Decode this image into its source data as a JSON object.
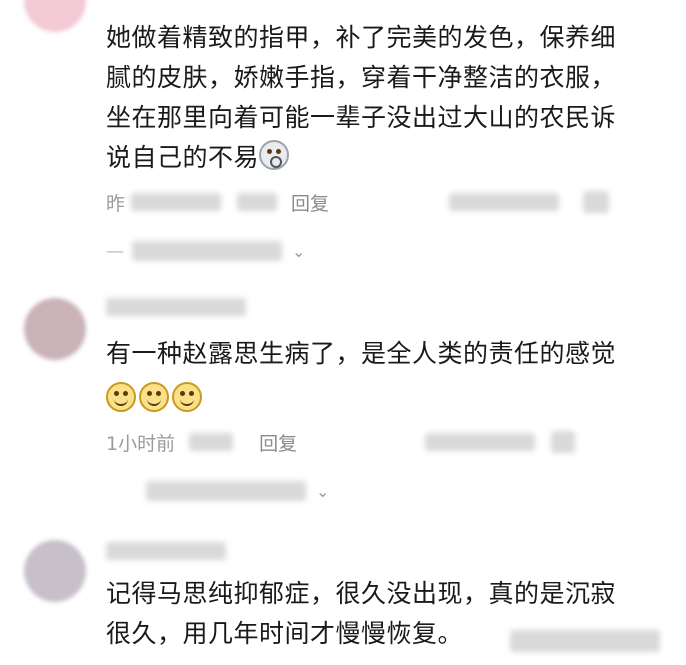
{
  "comments": [
    {
      "lines": [
        "她做着精致的指甲，补了完美的发色，保养细",
        "腻的皮肤，娇嫩手指，穿着干净整洁的衣服，",
        "坐在那里向着可能一辈子没出过大山的农民诉",
        "说自己的不易"
      ],
      "emoji": "scared-face",
      "time": "昨",
      "reply": "回复",
      "sub_dash": "—",
      "avatar_color": "#f2c9d4"
    },
    {
      "lines": [
        "有一种赵露思生病了，是全人类的责任的感觉"
      ],
      "emoji": "smiling-face",
      "emoji_count": 3,
      "time": "1小时前",
      "reply": "回复",
      "avatar_color": "#c9b2b8"
    },
    {
      "lines": [
        "记得马思纯抑郁症，很久没出现，真的是沉寂",
        "很久，用几年时间才慢慢恢复。"
      ],
      "avatar_color": "#c7bfc9"
    }
  ]
}
